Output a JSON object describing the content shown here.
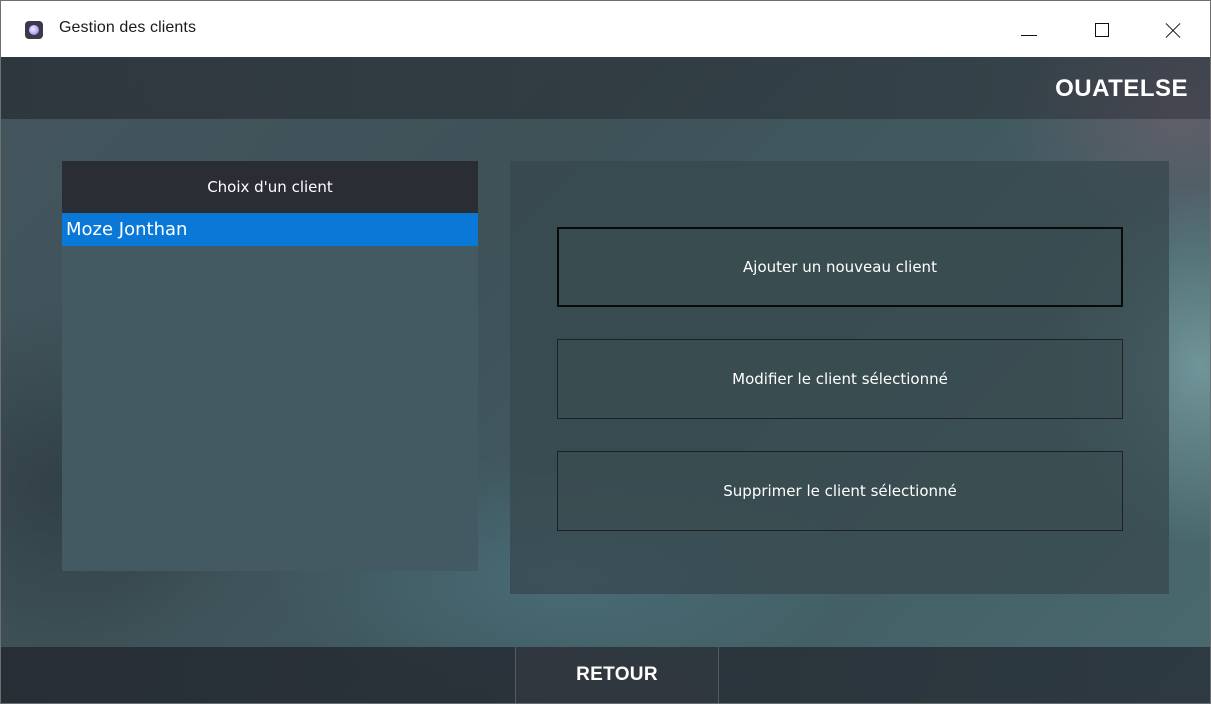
{
  "window": {
    "title": "Gestion des clients"
  },
  "header": {
    "brand": "OUATELSE"
  },
  "clients": {
    "header": "Choix d'un client",
    "items": [
      "Moze Jonthan"
    ],
    "selected": "Moze Jonthan"
  },
  "actions": {
    "add": "Ajouter un nouveau client",
    "edit": "Modifier le client sélectionné",
    "delete": "Supprimer le client sélectionné"
  },
  "footer": {
    "back": "RETOUR"
  },
  "colors": {
    "selection": "#0a78d7",
    "list_bg": "#445a63",
    "header_bg": "#2b2d35"
  }
}
